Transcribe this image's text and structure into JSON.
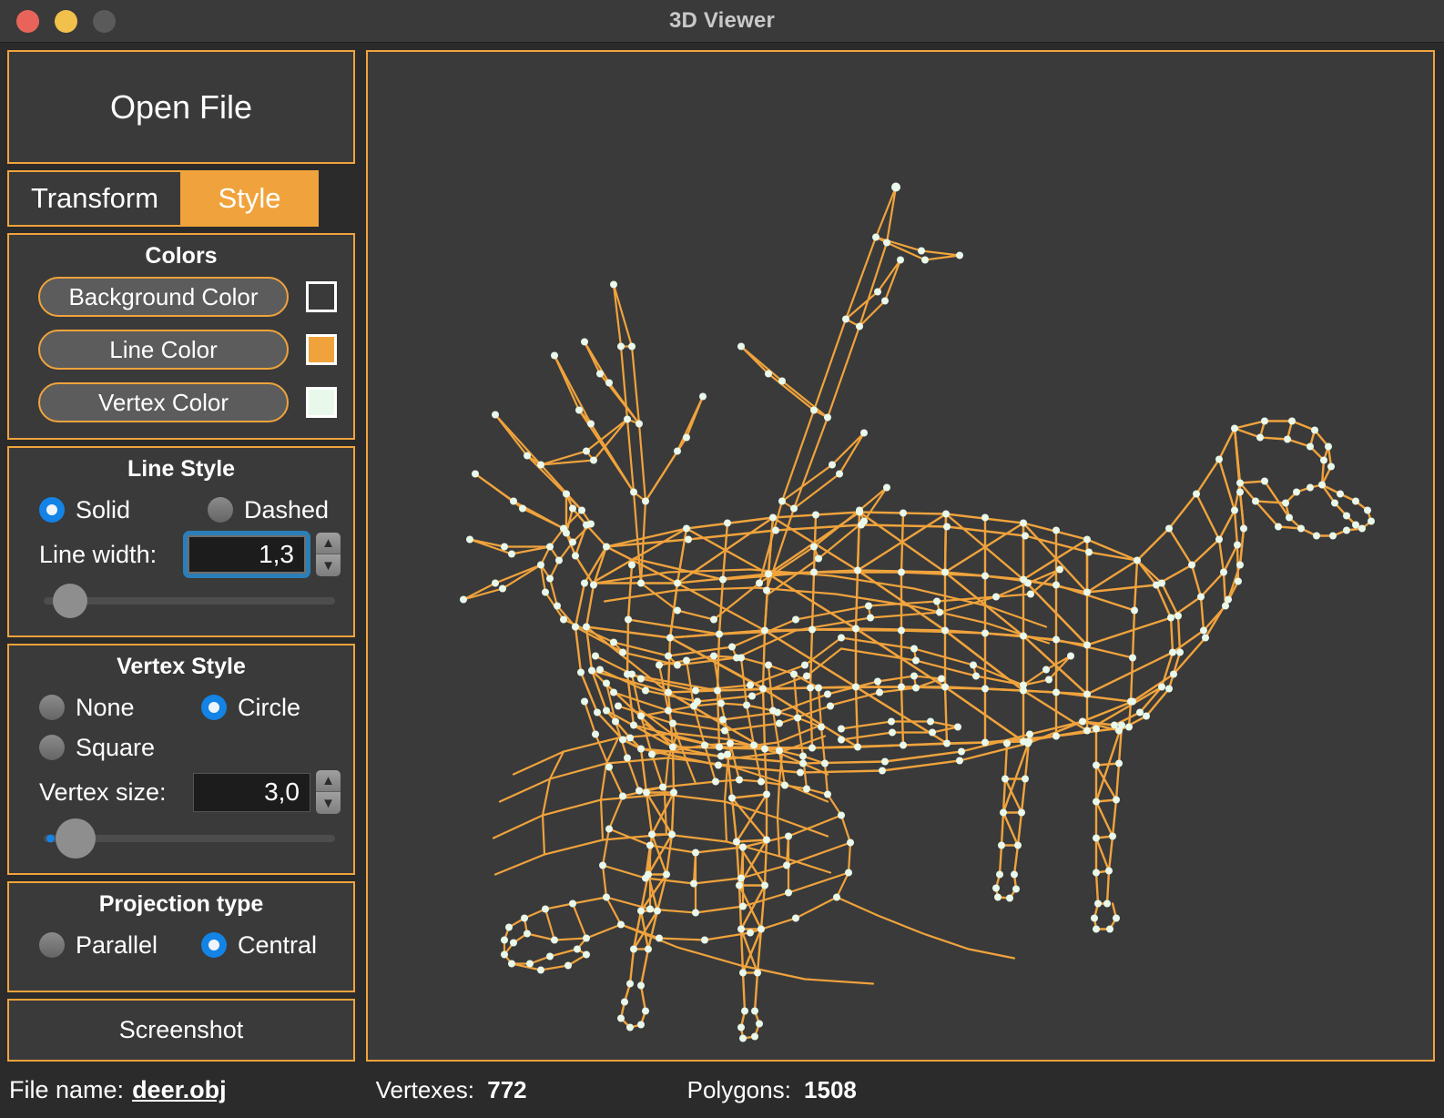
{
  "window": {
    "title": "3D Viewer",
    "traffic_lights": [
      {
        "name": "close",
        "color": "#e8645a"
      },
      {
        "name": "minimize",
        "color": "#f2c14b"
      },
      {
        "name": "zoom",
        "color": "#5a5a5a"
      }
    ]
  },
  "sidebar": {
    "open_file_label": "Open File",
    "tabs": [
      {
        "label": "Transform",
        "active": false
      },
      {
        "label": "Style",
        "active": true
      }
    ],
    "colors": {
      "title": "Colors",
      "rows": [
        {
          "label": "Background Color",
          "swatch": "#3a3a3a"
        },
        {
          "label": "Line Color",
          "swatch": "#f0a33c"
        },
        {
          "label": "Vertex Color",
          "swatch": "#e8f8ea"
        }
      ]
    },
    "line_style": {
      "title": "Line Style",
      "options": [
        {
          "label": "Solid",
          "selected": true
        },
        {
          "label": "Dashed",
          "selected": false
        }
      ],
      "width_label": "Line width:",
      "width_value": "1,3",
      "slider_position_pct": 3
    },
    "vertex_style": {
      "title": "Vertex Style",
      "options": [
        {
          "label": "None",
          "selected": false
        },
        {
          "label": "Circle",
          "selected": true
        },
        {
          "label": "Square",
          "selected": false
        }
      ],
      "size_label": "Vertex size:",
      "size_value": "3,0",
      "slider_position_pct": 4
    },
    "projection": {
      "title": "Projection type",
      "options": [
        {
          "label": "Parallel",
          "selected": false
        },
        {
          "label": "Central",
          "selected": true
        }
      ]
    },
    "screenshot_label": "Screenshot"
  },
  "viewport": {
    "model": "deer wireframe",
    "background": "#3a3a3a",
    "line_color": "#f0a33c",
    "vertex_color": "#e8f8ea"
  },
  "statusbar": {
    "file_label": "File name:",
    "file_value": "deer.obj",
    "vertexes_label": "Vertexes:",
    "vertexes_value": "772",
    "polygons_label": "Polygons:",
    "polygons_value": "1508"
  }
}
